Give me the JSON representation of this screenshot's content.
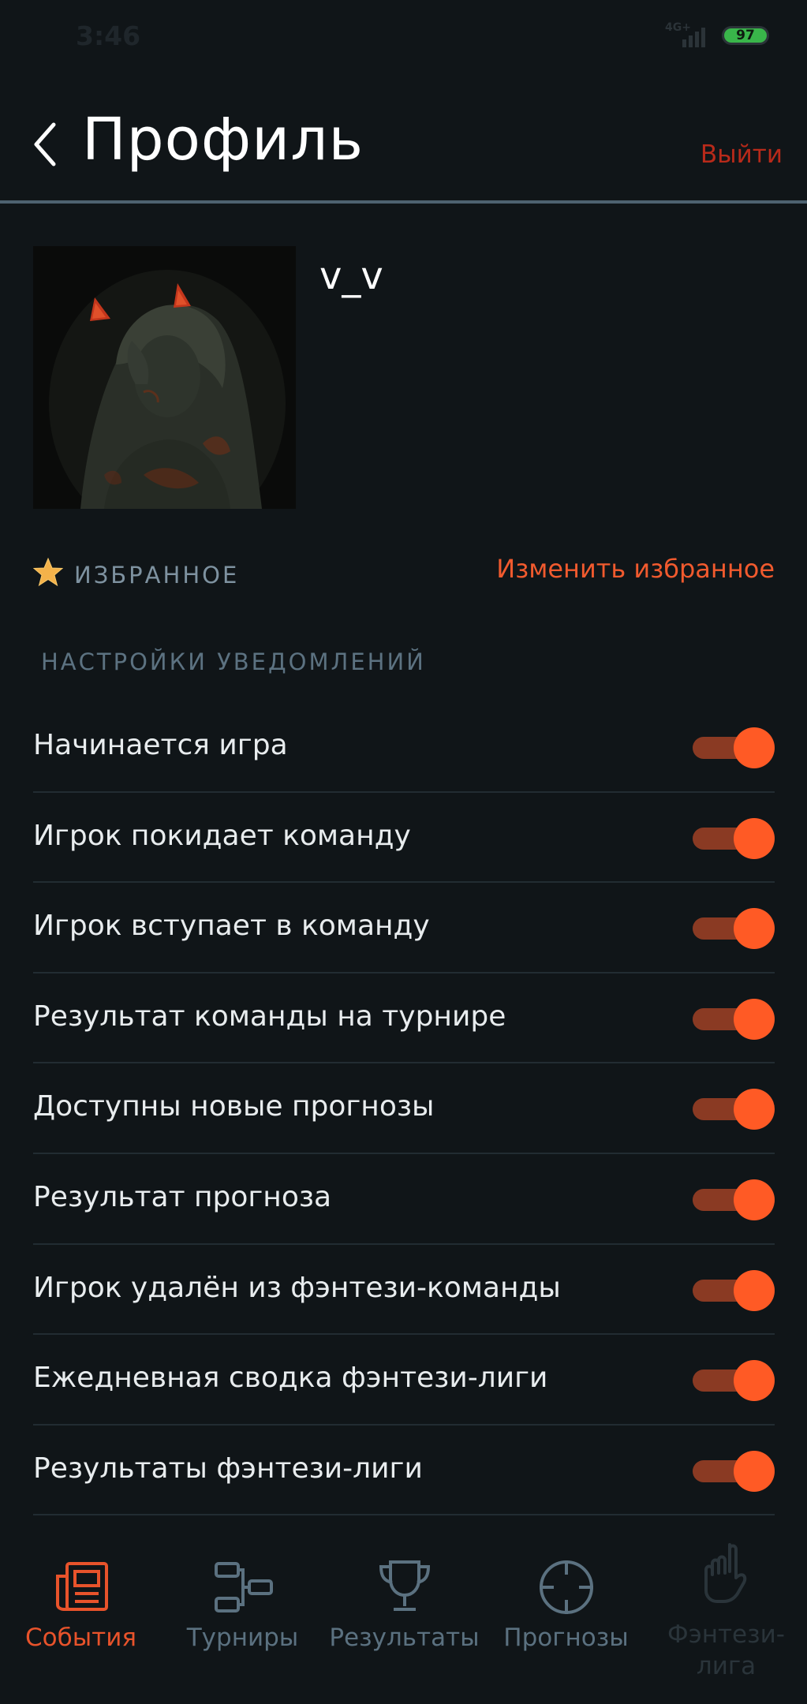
{
  "status_bar": {
    "time": "3:46",
    "network": "4G+",
    "battery": "97"
  },
  "header": {
    "title": "Профиль",
    "logout_label": "Выйти"
  },
  "profile": {
    "username": "v_v"
  },
  "favorites": {
    "label": "ИЗБРАННОЕ",
    "edit_label": "Изменить избранное"
  },
  "notifications": {
    "section_title": "НАСТРОЙКИ УВЕДОМЛЕНИЙ",
    "items": [
      {
        "label": "Начинается игра",
        "enabled": true
      },
      {
        "label": "Игрок покидает команду",
        "enabled": true
      },
      {
        "label": "Игрок вступает в команду",
        "enabled": true
      },
      {
        "label": "Результат команды на турнире",
        "enabled": true
      },
      {
        "label": "Доступны новые прогнозы",
        "enabled": true
      },
      {
        "label": "Результат прогноза",
        "enabled": true
      },
      {
        "label": "Игрок удалён из фэнтези-команды",
        "enabled": true
      },
      {
        "label": "Ежедневная сводка фэнтези-лиги",
        "enabled": true
      },
      {
        "label": "Результаты фэнтези-лиги",
        "enabled": true
      }
    ]
  },
  "bottom_nav": {
    "items": [
      {
        "label": "События",
        "icon": "newspaper-icon",
        "state": "active"
      },
      {
        "label": "Турниры",
        "icon": "bracket-icon",
        "state": "normal"
      },
      {
        "label": "Результаты",
        "icon": "trophy-icon",
        "state": "normal"
      },
      {
        "label": "Прогнозы",
        "icon": "crosshair-icon",
        "state": "normal"
      },
      {
        "label": "Фэнтези-лига",
        "label_line1": "Фэнтези-",
        "label_line2": "лига",
        "icon": "hand-icon",
        "state": "disabled"
      }
    ]
  },
  "colors": {
    "background": "#101518",
    "accent": "#ff5a25",
    "accent_text": "#f15a2e",
    "logout": "#b82a1a",
    "muted": "#7e92a0",
    "divider": "#4e6270"
  }
}
